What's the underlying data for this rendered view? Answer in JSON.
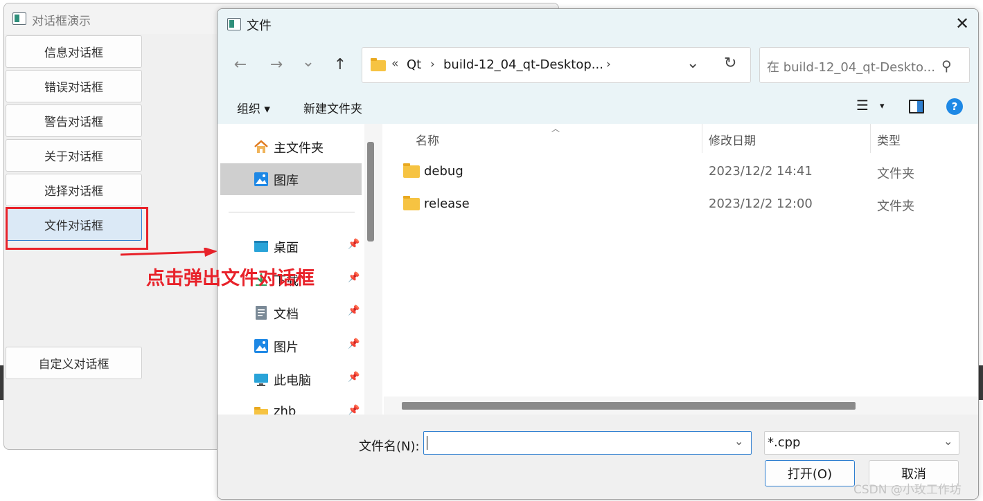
{
  "main_window": {
    "title": "对话框演示",
    "buttons": [
      {
        "label": "信息对话框"
      },
      {
        "label": "错误对话框"
      },
      {
        "label": "警告对话框"
      },
      {
        "label": "关于对话框"
      },
      {
        "label": "选择对话框"
      },
      {
        "label": "文件对话框"
      },
      {
        "label": "自定义对话框"
      }
    ]
  },
  "annotation": {
    "text": "点击弹出文件对话框",
    "color": "#e8222a"
  },
  "dialog": {
    "title": "文件",
    "close_label": "✕",
    "nav": {
      "back_icon": "←",
      "forward_icon": "→",
      "recent_icon": "⌄",
      "up_icon": "↑",
      "refresh_icon": "↻"
    },
    "address": {
      "overflow": "«",
      "crumbs": [
        "Qt",
        "build-12_04_qt-Desktop..."
      ],
      "sep": "›",
      "dropdown_icon": "⌄"
    },
    "search": {
      "placeholder": "在 build-12_04_qt-Deskto...",
      "icon": "⚲"
    },
    "toolbar": {
      "organize": "组织 ▾",
      "new_folder": "新建文件夹",
      "view_icon": "☰",
      "view_dd": "▾",
      "help_icon": "?"
    },
    "sidebar": {
      "items": [
        {
          "label": "主文件夹",
          "icon": "home-icon"
        },
        {
          "label": "图库",
          "icon": "gallery-icon"
        },
        {
          "label": "桌面",
          "icon": "desktop-icon"
        },
        {
          "label": "下载",
          "icon": "download-icon"
        },
        {
          "label": "文档",
          "icon": "document-icon"
        },
        {
          "label": "图片",
          "icon": "pictures-icon"
        },
        {
          "label": "此电脑",
          "icon": "pc-icon"
        },
        {
          "label": "zhb",
          "icon": "folder-icon"
        }
      ],
      "pin": "📌"
    },
    "columns": {
      "name": "名称",
      "modified": "修改日期",
      "type": "类型"
    },
    "files": [
      {
        "name": "debug",
        "modified": "2023/12/2 14:41",
        "type": "文件夹"
      },
      {
        "name": "release",
        "modified": "2023/12/2 12:00",
        "type": "文件夹"
      }
    ],
    "filename_label": "文件名(N):",
    "filename_value": "",
    "filter_value": "*.cpp",
    "open_label": "打开(O)",
    "cancel_label": "取消",
    "dropdown_icon": "⌄"
  },
  "watermark": "CSDN @小玫工作坊",
  "colors": {
    "accent": "#2f7fd0",
    "dialog_chrome": "#eaf4f7",
    "highlight_red": "#e8222a"
  }
}
